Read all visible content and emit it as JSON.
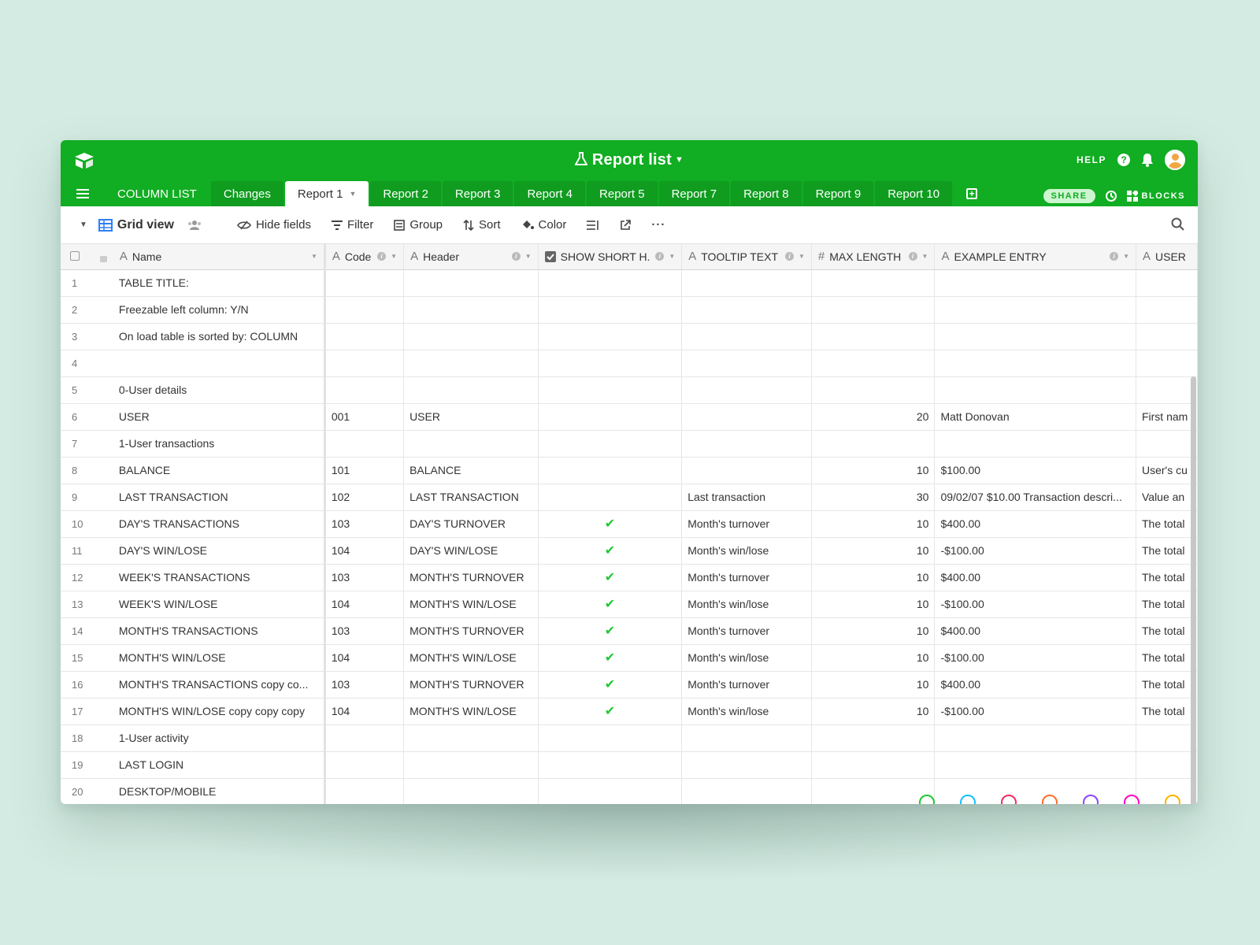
{
  "app": {
    "base_title": "Report list",
    "help_label": "HELP",
    "share_label": "SHARE",
    "blocks_label": "BLOCKS",
    "accent": "#11ad22"
  },
  "tabs": [
    {
      "label": "COLUMN LIST",
      "active": false
    },
    {
      "label": "Changes",
      "active": false
    },
    {
      "label": "Report 1",
      "active": true
    },
    {
      "label": "Report 2",
      "active": false
    },
    {
      "label": "Report 3",
      "active": false
    },
    {
      "label": "Report 4",
      "active": false
    },
    {
      "label": "Report 5",
      "active": false
    },
    {
      "label": "Report 7",
      "active": false
    },
    {
      "label": "Report 8",
      "active": false
    },
    {
      "label": "Report 9",
      "active": false
    },
    {
      "label": "Report 10",
      "active": false
    }
  ],
  "toolbar": {
    "view_label": "Grid view",
    "hide_fields": "Hide fields",
    "filter": "Filter",
    "group": "Group",
    "sort": "Sort",
    "color": "Color"
  },
  "columns": {
    "name": "Name",
    "code": "Code",
    "header": "Header",
    "show_short": "SHOW SHORT H.",
    "tooltip": "TOOLTIP TEXT",
    "max_length": "MAX LENGTH",
    "example": "EXAMPLE ENTRY",
    "user": "USER"
  },
  "rows": [
    {
      "n": "1",
      "name": "TABLE TITLE:",
      "code": "",
      "header": "",
      "check": false,
      "tooltip": "",
      "max": "",
      "example": "",
      "user": ""
    },
    {
      "n": "2",
      "name": "Freezable left column: Y/N",
      "code": "",
      "header": "",
      "check": false,
      "tooltip": "",
      "max": "",
      "example": "",
      "user": ""
    },
    {
      "n": "3",
      "name": "On load table is sorted by: COLUMN",
      "code": "",
      "header": "",
      "check": false,
      "tooltip": "",
      "max": "",
      "example": "",
      "user": ""
    },
    {
      "n": "4",
      "name": "",
      "code": "",
      "header": "",
      "check": false,
      "tooltip": "",
      "max": "",
      "example": "",
      "user": ""
    },
    {
      "n": "5",
      "name": "0-User details",
      "code": "",
      "header": "",
      "check": false,
      "tooltip": "",
      "max": "",
      "example": "",
      "user": ""
    },
    {
      "n": "6",
      "name": "USER",
      "code": "001",
      "header": "USER",
      "check": false,
      "tooltip": "",
      "max": "20",
      "example": "Matt  Donovan",
      "user": "First nam"
    },
    {
      "n": "7",
      "name": "1-User transactions",
      "code": "",
      "header": "",
      "check": false,
      "tooltip": "",
      "max": "",
      "example": "",
      "user": ""
    },
    {
      "n": "8",
      "name": "BALANCE",
      "code": "101",
      "header": "BALANCE",
      "check": false,
      "tooltip": "",
      "max": "10",
      "example": "$100.00",
      "user": "User's cu"
    },
    {
      "n": "9",
      "name": "LAST TRANSACTION",
      "code": "102",
      "header": "LAST TRANSACTION",
      "check": false,
      "tooltip": "Last transaction",
      "max": "30",
      "example": "09/02/07 $10.00 Transaction descri...",
      "user": "Value an"
    },
    {
      "n": "10",
      "name": "DAY'S TRANSACTIONS",
      "code": "103",
      "header": "DAY'S TURNOVER",
      "check": true,
      "tooltip": "Month's turnover",
      "max": "10",
      "example": "$400.00",
      "user": "The total"
    },
    {
      "n": "11",
      "name": "DAY'S WIN/LOSE",
      "code": "104",
      "header": "DAY'S WIN/LOSE",
      "check": true,
      "tooltip": "Month's win/lose",
      "max": "10",
      "example": "-$100.00",
      "user": "The total"
    },
    {
      "n": "12",
      "name": "WEEK'S TRANSACTIONS",
      "code": "103",
      "header": "MONTH'S TURNOVER",
      "check": true,
      "tooltip": "Month's turnover",
      "max": "10",
      "example": "$400.00",
      "user": "The total"
    },
    {
      "n": "13",
      "name": "WEEK'S WIN/LOSE",
      "code": "104",
      "header": "MONTH'S WIN/LOSE",
      "check": true,
      "tooltip": "Month's win/lose",
      "max": "10",
      "example": "-$100.00",
      "user": "The total"
    },
    {
      "n": "14",
      "name": "MONTH'S TRANSACTIONS",
      "code": "103",
      "header": "MONTH'S TURNOVER",
      "check": true,
      "tooltip": "Month's turnover",
      "max": "10",
      "example": "$400.00",
      "user": "The total"
    },
    {
      "n": "15",
      "name": "MONTH'S WIN/LOSE",
      "code": "104",
      "header": "MONTH'S WIN/LOSE",
      "check": true,
      "tooltip": "Month's win/lose",
      "max": "10",
      "example": "-$100.00",
      "user": "The total"
    },
    {
      "n": "16",
      "name": "MONTH'S TRANSACTIONS copy co...",
      "code": "103",
      "header": "MONTH'S TURNOVER",
      "check": true,
      "tooltip": "Month's turnover",
      "max": "10",
      "example": "$400.00",
      "user": "The total"
    },
    {
      "n": "17",
      "name": "MONTH'S WIN/LOSE copy copy copy",
      "code": "104",
      "header": "MONTH'S WIN/LOSE",
      "check": true,
      "tooltip": "Month's win/lose",
      "max": "10",
      "example": "-$100.00",
      "user": "The total"
    },
    {
      "n": "18",
      "name": "1-User activity",
      "code": "",
      "header": "",
      "check": false,
      "tooltip": "",
      "max": "",
      "example": "",
      "user": ""
    },
    {
      "n": "19",
      "name": "LAST LOGIN",
      "code": "",
      "header": "",
      "check": false,
      "tooltip": "",
      "max": "",
      "example": "",
      "user": ""
    },
    {
      "n": "20",
      "name": "DESKTOP/MOBILE",
      "code": "",
      "header": "",
      "check": false,
      "tooltip": "",
      "max": "",
      "example": "",
      "user": ""
    }
  ],
  "check_glyph": "✔",
  "dot_colors": [
    "#20c933",
    "#18bfff",
    "#f82b60",
    "#ff6f2c",
    "#8b46ff",
    "#ff08c2",
    "#fcb400"
  ]
}
